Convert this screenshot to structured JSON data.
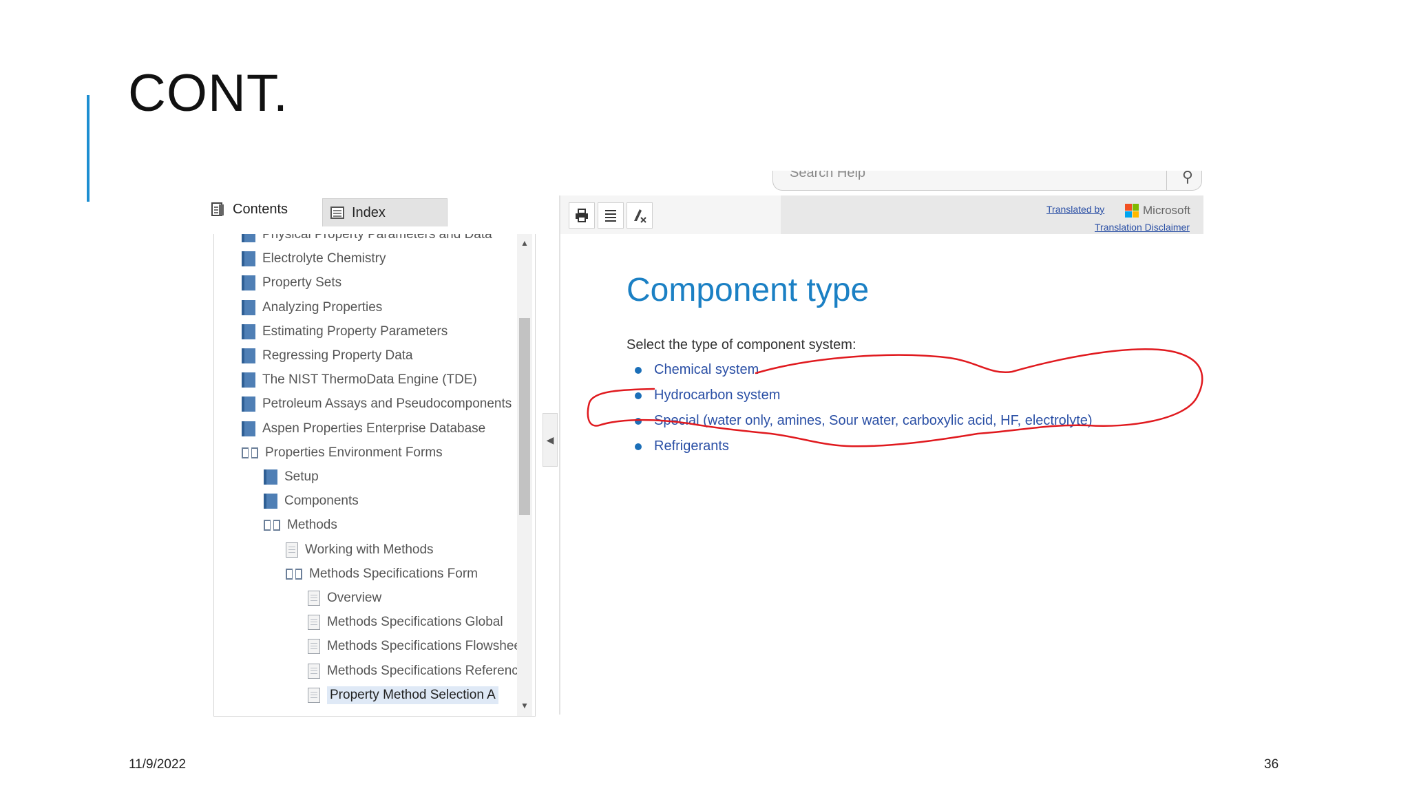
{
  "slide": {
    "title": "CONT.",
    "date": "11/9/2022",
    "page_number": "36",
    "accent_color": "#1c8ed1"
  },
  "help_window": {
    "tabs": [
      {
        "label": "Contents",
        "icon": "contents-icon",
        "active": true
      },
      {
        "label": "Index",
        "icon": "index-icon",
        "active": false
      }
    ],
    "tree": [
      {
        "label": "Physical Property Parameters and Data",
        "icon": "book-closed",
        "level": 0
      },
      {
        "label": "Electrolyte Chemistry",
        "icon": "book-closed",
        "level": 0
      },
      {
        "label": "Property Sets",
        "icon": "book-closed",
        "level": 0
      },
      {
        "label": "Analyzing Properties",
        "icon": "book-closed",
        "level": 0
      },
      {
        "label": "Estimating Property Parameters",
        "icon": "book-closed",
        "level": 0
      },
      {
        "label": "Regressing Property Data",
        "icon": "book-closed",
        "level": 0
      },
      {
        "label": "The NIST ThermoData Engine (TDE)",
        "icon": "book-closed",
        "level": 0
      },
      {
        "label": "Petroleum Assays and Pseudocomponents",
        "icon": "book-closed",
        "level": 0
      },
      {
        "label": "Aspen Properties Enterprise Database",
        "icon": "book-closed",
        "level": 0
      },
      {
        "label": "Properties Environment Forms",
        "icon": "book-open",
        "level": 0
      },
      {
        "label": "Setup",
        "icon": "book-closed",
        "level": 1
      },
      {
        "label": "Components",
        "icon": "book-closed",
        "level": 1
      },
      {
        "label": "Methods",
        "icon": "book-open",
        "level": 1
      },
      {
        "label": "Working with Methods",
        "icon": "page",
        "level": 2
      },
      {
        "label": "Methods Specifications Form",
        "icon": "book-open",
        "level": 2
      },
      {
        "label": "Overview",
        "icon": "page",
        "level": 3
      },
      {
        "label": "Methods Specifications Global",
        "icon": "page",
        "level": 3
      },
      {
        "label": "Methods Specifications Flowsheet",
        "icon": "page",
        "level": 3
      },
      {
        "label": "Methods Specifications Referenced",
        "icon": "page",
        "level": 3
      },
      {
        "label": "Property Method Selection A",
        "icon": "page",
        "level": 3,
        "selected": true
      }
    ],
    "toolbar": {
      "buttons": [
        "print-icon",
        "list-icon",
        "clear-highlight-icon"
      ],
      "translated_by": "Translated by",
      "translator": "Microsoft",
      "disclaimer": "Translation Disclaimer"
    },
    "search": {
      "placeholder": "Search Help"
    },
    "content": {
      "heading": "Component type",
      "intro": "Select the type of component system:",
      "items": [
        "Chemical system",
        "Hydrocarbon system",
        "Special (water only, amines, Sour water, carboxylic acid, HF, electrolyte)",
        "Refrigerants"
      ]
    }
  },
  "annotation": {
    "color": "#e0191e",
    "circled_item": "Special (water only, amines, Sour water, carboxylic acid, HF, electrolyte)"
  }
}
